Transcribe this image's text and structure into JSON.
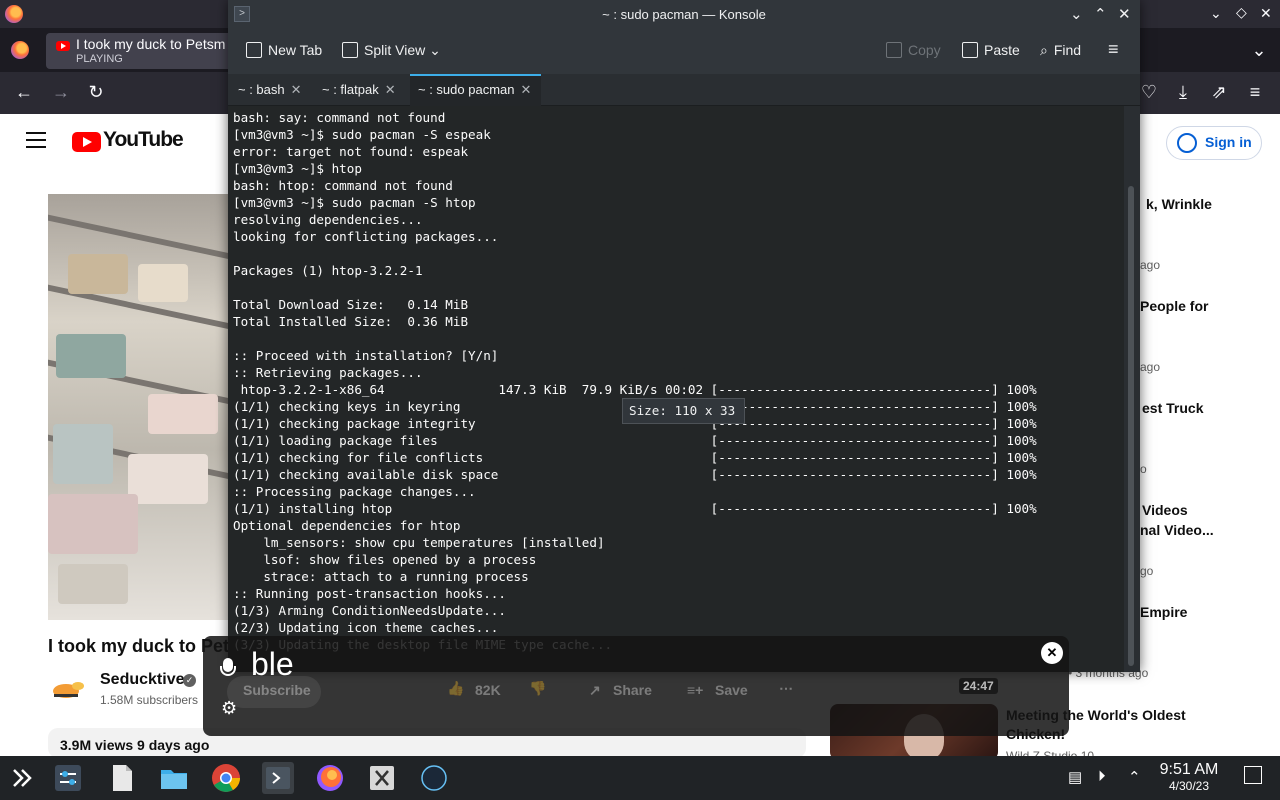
{
  "firefox": {
    "tab_title": "I took my duck to Petsm",
    "tab_status": "PLAYING"
  },
  "youtube": {
    "logo_text": "YouTube",
    "signin_label": "Sign in",
    "video_title": "I took my duck to Pet",
    "channel_name": "Seducktive",
    "subscribers": "1.58M subscribers",
    "subscribe_label": "Subscribe",
    "likes": "82K",
    "share_label": "Share",
    "save_label": "Save",
    "views_date": "3.9M views  9 days ago",
    "recs": [
      {
        "text": "k, Wrinkle"
      },
      {
        "text": "ago"
      },
      {
        "text": "People for"
      },
      {
        "text": "ago"
      },
      {
        "text": "est Truck"
      },
      {
        "text": "o"
      },
      {
        "text": "Videos"
      },
      {
        "text": "nal Video..."
      },
      {
        "text": "go"
      },
      {
        "text": "Empire"
      },
      {
        "text": "• 3 months ago"
      }
    ],
    "rec_duration": "24:47",
    "rec2_title": "Meeting the World's Oldest Chicken!",
    "rec2_meta": "Wild Z Studio 10"
  },
  "konsole": {
    "window_title": "~ : sudo pacman — Konsole",
    "toolbar": {
      "new_tab": "New Tab",
      "split_view": "Split View",
      "copy": "Copy",
      "paste": "Paste",
      "find": "Find"
    },
    "tabs": [
      {
        "label": "~ : bash"
      },
      {
        "label": "~ : flatpak"
      },
      {
        "label": "~ : sudo pacman"
      }
    ],
    "lines": [
      "bash: say: command not found",
      "[vm3@vm3 ~]$ sudo pacman -S espeak",
      "error: target not found: espeak",
      "[vm3@vm3 ~]$ htop",
      "bash: htop: command not found",
      "[vm3@vm3 ~]$ sudo pacman -S htop",
      "resolving dependencies...",
      "looking for conflicting packages...",
      "",
      "Packages (1) htop-3.2.2-1",
      "",
      "Total Download Size:   0.14 MiB",
      "Total Installed Size:  0.36 MiB",
      "",
      ":: Proceed with installation? [Y/n]",
      ":: Retrieving packages...",
      " htop-3.2.2-1-x86_64               147.3 KiB  79.9 KiB/s 00:02 [------------------------------------] 100%",
      "(1/1) checking keys in keyring                                 [------------------------------------] 100%",
      "(1/1) checking package integrity                               [------------------------------------] 100%",
      "(1/1) loading package files                                    [------------------------------------] 100%",
      "(1/1) checking for file conflicts                              [------------------------------------] 100%",
      "(1/1) checking available disk space                            [------------------------------------] 100%",
      ":: Processing package changes...",
      "(1/1) installing htop                                          [------------------------------------] 100%",
      "Optional dependencies for htop",
      "    lm_sensors: show cpu temperatures [installed]",
      "    lsof: show files opened by a process",
      "    strace: attach to a running process",
      ":: Running post-transaction hooks...",
      "(1/3) Arming ConditionNeedsUpdate...",
      "(2/3) Updating icon theme caches...",
      "(3/3) Updating the desktop file MIME type cache..."
    ],
    "size_tooltip": "Size: 110 x 33"
  },
  "voice": {
    "transcript": "ble"
  },
  "taskbar": {
    "time": "9:51 AM",
    "date": "4/30/23"
  },
  "colors": {
    "konsole_bg": "#232627",
    "accent": "#3daee9",
    "youtube_red": "#ff0000"
  }
}
